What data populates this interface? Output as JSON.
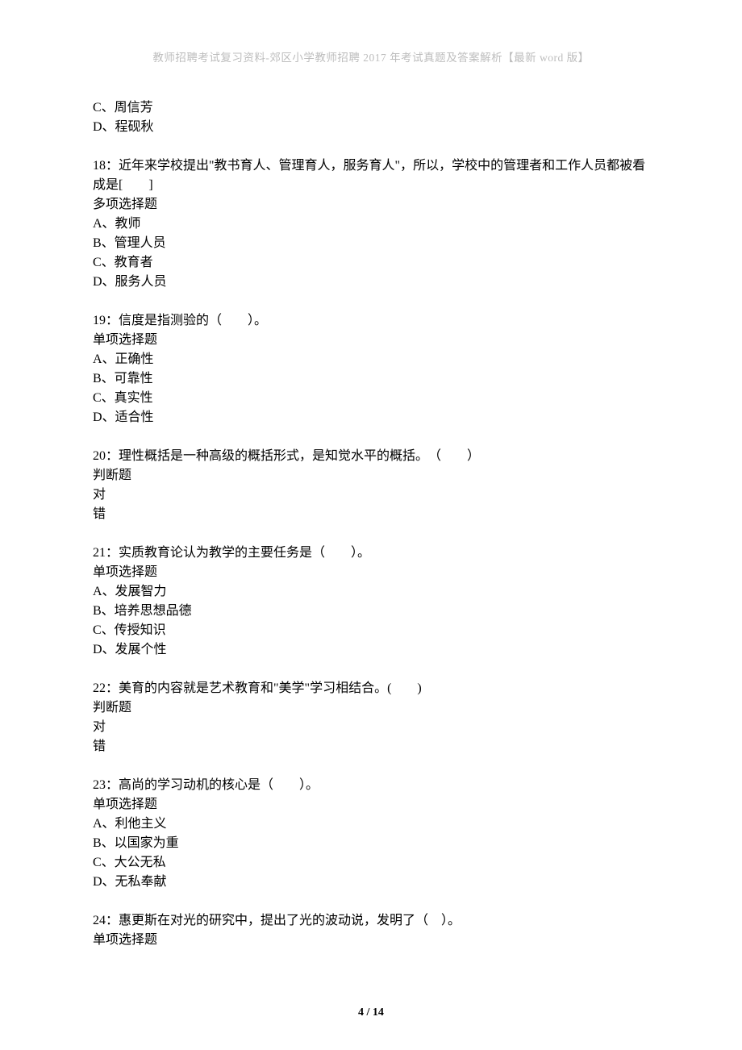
{
  "header": "教师招聘考试复习资料-郊区小学教师招聘 2017 年考试真题及答案解析【最新 word 版】",
  "footer": "4 / 14",
  "q17": {
    "optC": "C、周信芳",
    "optD": "D、程砚秋"
  },
  "q18": {
    "stem": "18：近年来学校提出\"教书育人、管理育人，服务育人\"，所以，学校中的管理者和工作人员都被看成是[　　]",
    "type": "多项选择题",
    "optA": "A、教师",
    "optB": "B、管理人员",
    "optC": "C、教育者",
    "optD": "D、服务人员"
  },
  "q19": {
    "stem": "19：信度是指测验的（　　）。",
    "type": "单项选择题",
    "optA": "A、正确性",
    "optB": "B、可靠性",
    "optC": "C、真实性",
    "optD": "D、适合性"
  },
  "q20": {
    "stem": "20：理性概括是一种高级的概括形式，是知觉水平的概括。　（　　）",
    "type": "判断题",
    "optA": "对",
    "optB": "错"
  },
  "q21": {
    "stem": "21：实质教育论认为教学的主要任务是（　　）。",
    "type": "单项选择题",
    "optA": "A、发展智力",
    "optB": "B、培养思想品德",
    "optC": "C、传授知识",
    "optD": "D、发展个性"
  },
  "q22": {
    "stem": "22：美育的内容就是艺术教育和\"美学\"学习相结合。(　　)",
    "type": "判断题",
    "optA": "对",
    "optB": "错"
  },
  "q23": {
    "stem": "23：高尚的学习动机的核心是（　　）。",
    "type": "单项选择题",
    "optA": "A、利他主义",
    "optB": "B、以国家为重",
    "optC": "C、大公无私",
    "optD": "D、无私奉献"
  },
  "q24": {
    "stem": "24：惠更斯在对光的研究中，提出了光的波动说，发明了（　）。",
    "type": "单项选择题"
  }
}
